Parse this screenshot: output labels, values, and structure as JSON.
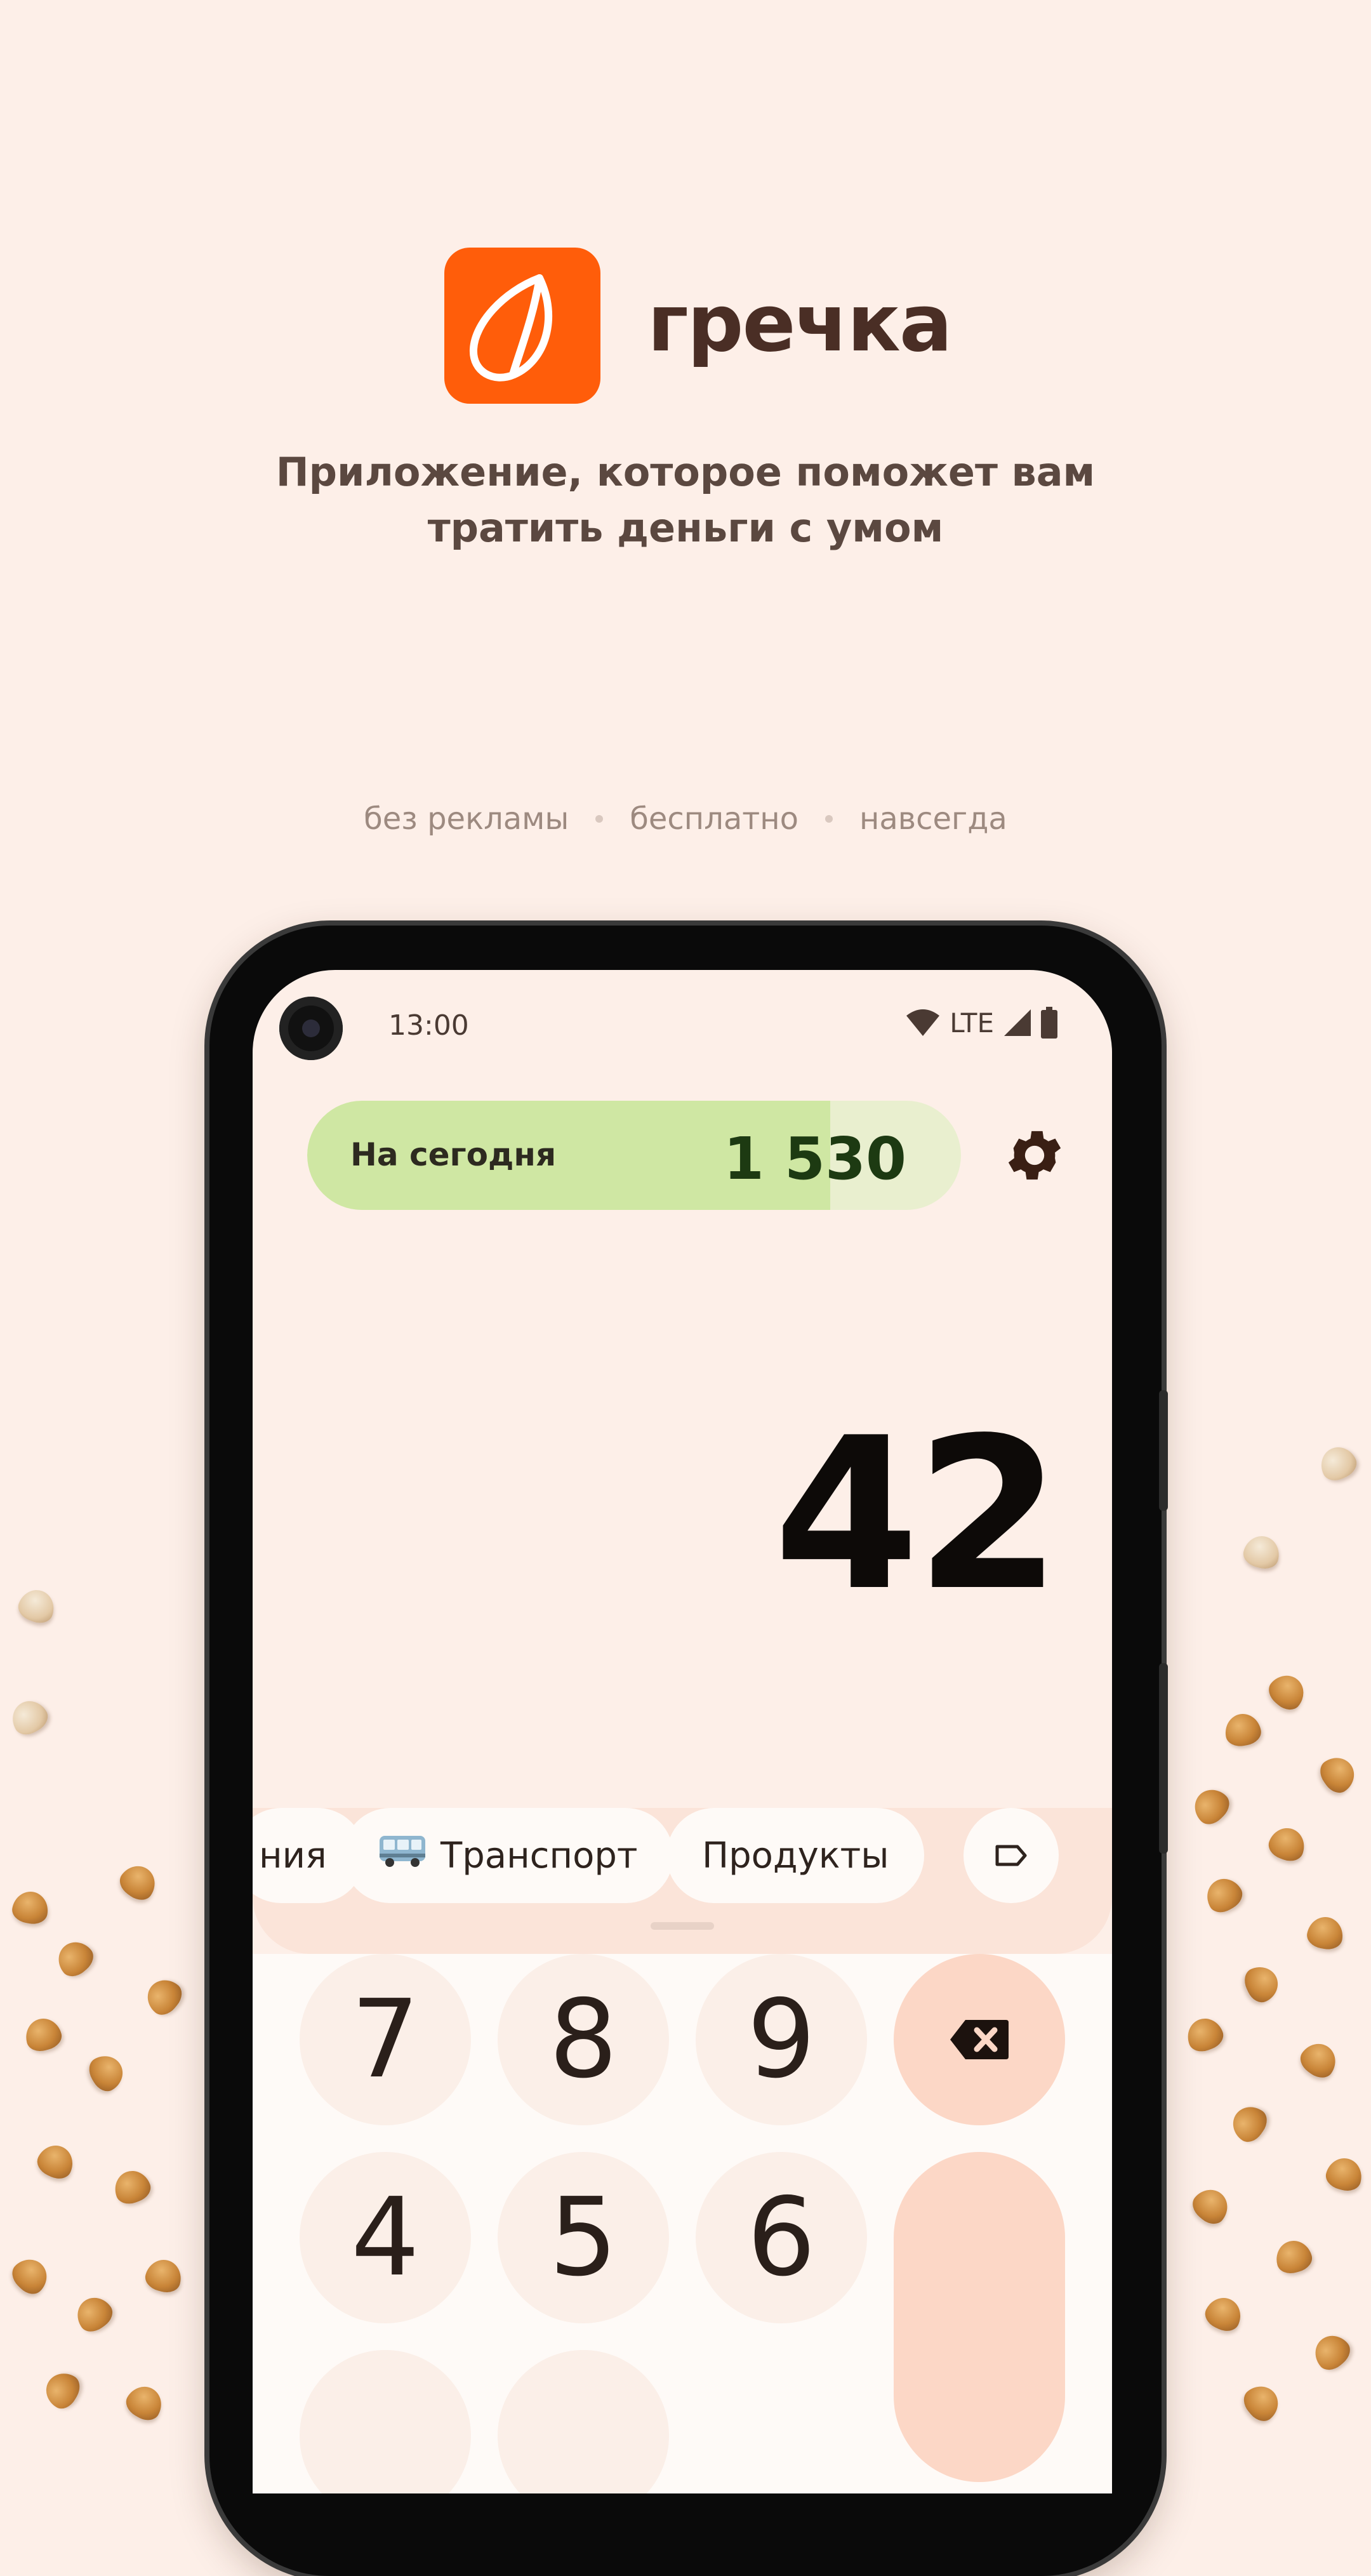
{
  "promo": {
    "app_name": "гречка",
    "tagline_line1": "Приложение, которое поможет вам",
    "tagline_line2": "тратить деньги с умом",
    "features": [
      "без рекламы",
      "бесплатно",
      "навсегда"
    ]
  },
  "status_bar": {
    "time": "13:00",
    "network": "LTE",
    "icons": [
      "wifi-icon",
      "signal-icon",
      "battery-icon"
    ]
  },
  "budget": {
    "label": "На сегодня",
    "value": "1 530",
    "fill_fraction": 0.8
  },
  "amount": {
    "value": "42"
  },
  "categories": {
    "chips": [
      {
        "label": "ния",
        "icon": null
      },
      {
        "label": "Транспорт",
        "icon": "bus-icon"
      },
      {
        "label": "Продукты",
        "icon": null
      }
    ],
    "tag_icon": "tag-icon"
  },
  "keypad": {
    "keys": [
      "7",
      "8",
      "9",
      "4",
      "5",
      "6"
    ],
    "backspace_icon": "backspace-icon"
  },
  "colors": {
    "brand": "#ff5d0a",
    "background": "#fdefe8",
    "budget_fill": "#cfe7a3",
    "accent_key": "#fcd7c6"
  }
}
